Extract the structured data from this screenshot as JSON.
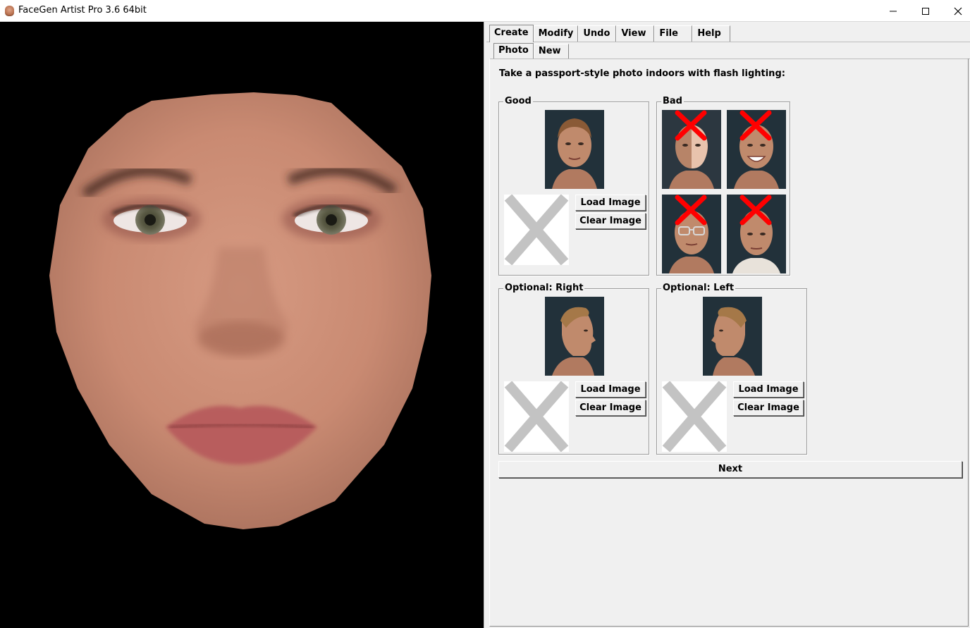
{
  "window": {
    "title": "FaceGen Artist Pro 3.6 64bit",
    "controls": [
      "minimize",
      "maximize",
      "close"
    ]
  },
  "main_tabs": [
    {
      "label": "Create",
      "active": true
    },
    {
      "label": "Modify",
      "active": false
    },
    {
      "label": "Undo",
      "active": false
    },
    {
      "label": "View",
      "active": false
    },
    {
      "label": "File",
      "active": false
    },
    {
      "label": "Help",
      "active": false
    }
  ],
  "sub_tabs": [
    {
      "label": "Photo",
      "active": true
    },
    {
      "label": "New",
      "active": false
    }
  ],
  "instruction": "Take a passport-style photo indoors with flash lighting:",
  "groups": {
    "good": {
      "title": "Good",
      "load_label": "Load Image",
      "clear_label": "Clear Image"
    },
    "bad": {
      "title": "Bad"
    },
    "right": {
      "title": "Optional: Right",
      "load_label": "Load Image",
      "clear_label": "Clear Image"
    },
    "left": {
      "title": "Optional: Left",
      "load_label": "Load Image",
      "clear_label": "Clear Image"
    }
  },
  "next_label": "Next",
  "colors": {
    "accent_red": "#ff0000",
    "placeholder_x": "#c3c3c3",
    "panel_bg": "#f0f0f0",
    "viewport_bg": "#000000",
    "skin": "#cf8f78"
  },
  "icons": {
    "app": "facegen-app-icon",
    "minimize": "minimize-icon",
    "maximize": "maximize-icon",
    "close": "close-icon",
    "reject": "red-x-icon",
    "empty_slot": "empty-image-x-icon"
  }
}
